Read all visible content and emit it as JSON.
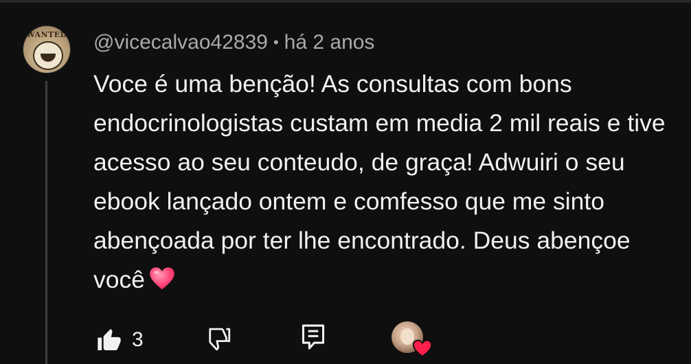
{
  "comment": {
    "username": "@vicecalvao42839",
    "separator": "•",
    "timestamp": "há 2 anos",
    "text": "Voce é uma benção! As consultas com bons endocrinologistas custam em media 2 mil reais e tive acesso ao seu conteudo, de graça! Adwuiri o seu ebook lançado ontem e comfesso que me sinto abençoada por ter lhe encontrado. Deus abençoe você",
    "emoji": "pink-heart-emoji",
    "avatar_text": "WANTED"
  },
  "actions": {
    "like_icon": "thumbs-up-filled-icon",
    "like_count": "3",
    "dislike_icon": "thumbs-down-outline-icon",
    "reply_icon": "reply-comment-icon",
    "creator_heart_icon": "creator-heart-badge-icon"
  },
  "colors": {
    "background": "#0f0f0f",
    "text_primary": "#f1f1f1",
    "text_secondary": "#aaaaaa",
    "thread_line": "#3f3f3f",
    "heart_red": "#ff1f4b",
    "emoji_pink": "#ff5a86"
  }
}
